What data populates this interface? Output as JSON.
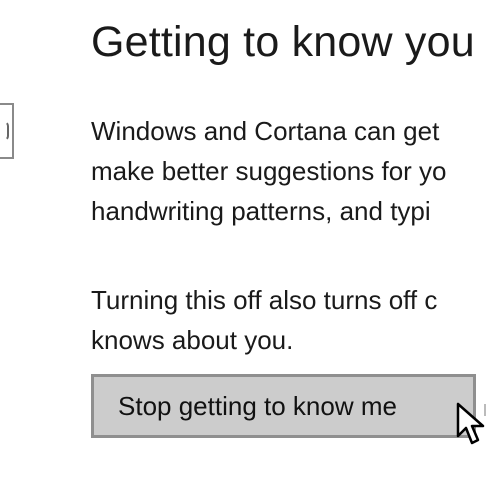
{
  "section": {
    "title": "Getting to know you",
    "paragraph_1_lines": [
      "Windows and Cortana can get",
      "make better suggestions for yo",
      "handwriting patterns, and typi"
    ],
    "paragraph_2_lines": [
      "Turning this off also turns off c",
      "knows about you."
    ]
  },
  "actions": {
    "stop_button_label": "Stop getting to know me"
  },
  "icons": {
    "cursor": "mouse-pointer-icon",
    "left_partial_control": "partially-visible-control"
  }
}
